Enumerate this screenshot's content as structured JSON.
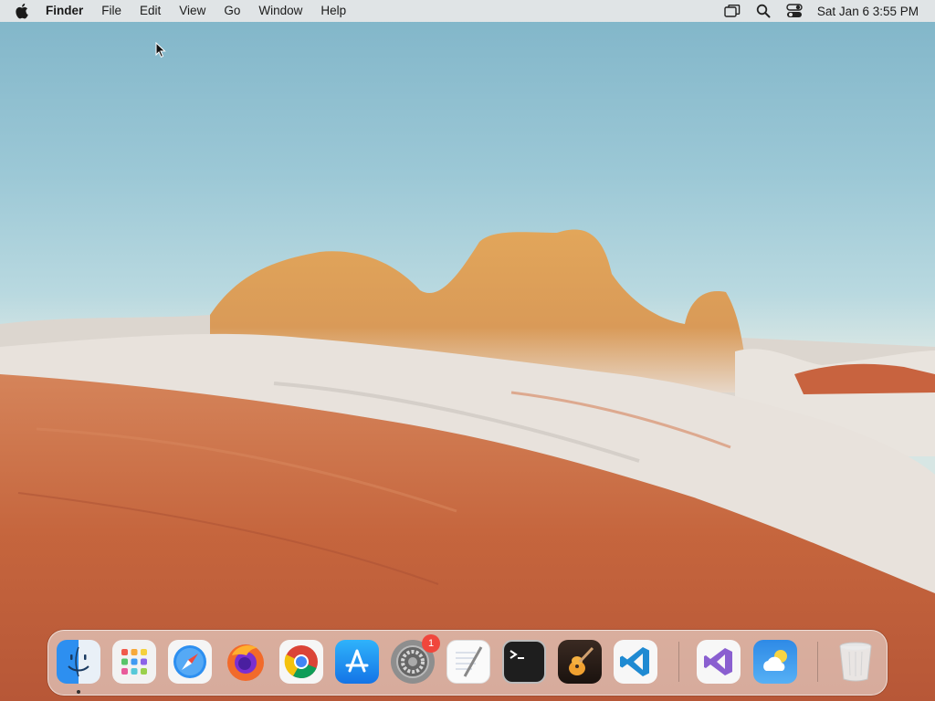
{
  "menubar": {
    "app_name": "Finder",
    "menus": [
      "File",
      "Edit",
      "View",
      "Go",
      "Window",
      "Help"
    ],
    "status_icons": [
      "screen-mirroring-icon",
      "spotlight-search-icon",
      "control-center-icon"
    ],
    "clock": "Sat Jan 6  3:55 PM"
  },
  "dock": {
    "apps": [
      {
        "name": "Finder",
        "icon": "finder-icon",
        "running": true
      },
      {
        "name": "Launchpad",
        "icon": "launchpad-icon"
      },
      {
        "name": "Safari",
        "icon": "safari-icon"
      },
      {
        "name": "Firefox",
        "icon": "firefox-icon"
      },
      {
        "name": "Google Chrome",
        "icon": "chrome-icon"
      },
      {
        "name": "App Store",
        "icon": "app-store-icon"
      },
      {
        "name": "System Settings",
        "icon": "system-settings-icon",
        "badge": "1"
      },
      {
        "name": "TextEdit",
        "icon": "textedit-icon"
      },
      {
        "name": "Terminal",
        "icon": "terminal-icon"
      },
      {
        "name": "GarageBand",
        "icon": "garageband-icon"
      },
      {
        "name": "Visual Studio Code",
        "icon": "vscode-icon"
      },
      {
        "name": "Visual Studio",
        "icon": "visual-studio-icon"
      },
      {
        "name": "Weather",
        "icon": "weather-icon"
      },
      {
        "name": "Trash",
        "icon": "trash-icon"
      }
    ]
  },
  "colors": {
    "menubar_bg": "#e8e8e8",
    "badge_red": "#f0463c",
    "sky": "#9cc8d6",
    "sandstone": "#c7673c"
  }
}
